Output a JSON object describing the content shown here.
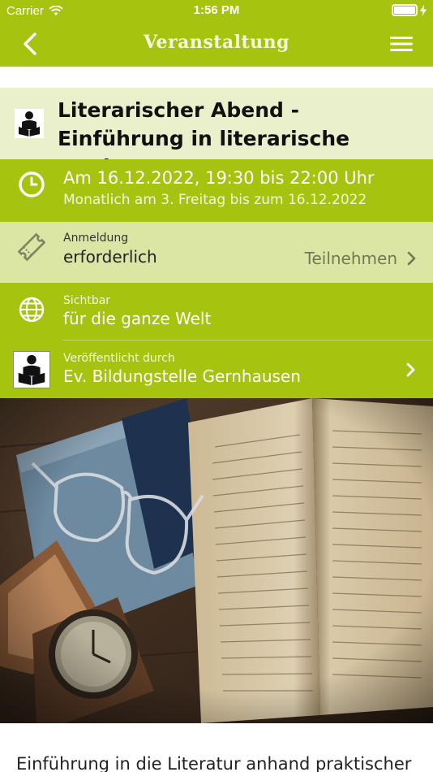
{
  "status_bar": {
    "carrier": "Carrier",
    "time": "1:56 PM"
  },
  "nav": {
    "title": "Veranstaltung",
    "back_icon": "chevron-left-icon",
    "menu_icon": "hamburger-menu-icon"
  },
  "event": {
    "title": "Literarischer Abend - Einführung in literarische Werke",
    "date_line": "Am 16.12.2022, 19:30 bis 22:00 Uhr",
    "recurrence": "Monatlich am 3. Freitag bis zum 16.12.2022",
    "registration_label": "Anmeldung",
    "registration_value": "erforderlich",
    "registration_action": "Teilnehmen",
    "visibility_label": "Sichtbar",
    "visibility_value": "für die ganze Welt",
    "publisher_label": "Veröffentlicht durch",
    "publisher_value": "Ev. Bildungstelle Gernhausen",
    "description_start": "Einführung in die Literatur anhand praktischer"
  },
  "colors": {
    "accent": "#a6c30f",
    "title_bg": "#eaf0cc",
    "registration_bg": "#dbe6a5"
  }
}
